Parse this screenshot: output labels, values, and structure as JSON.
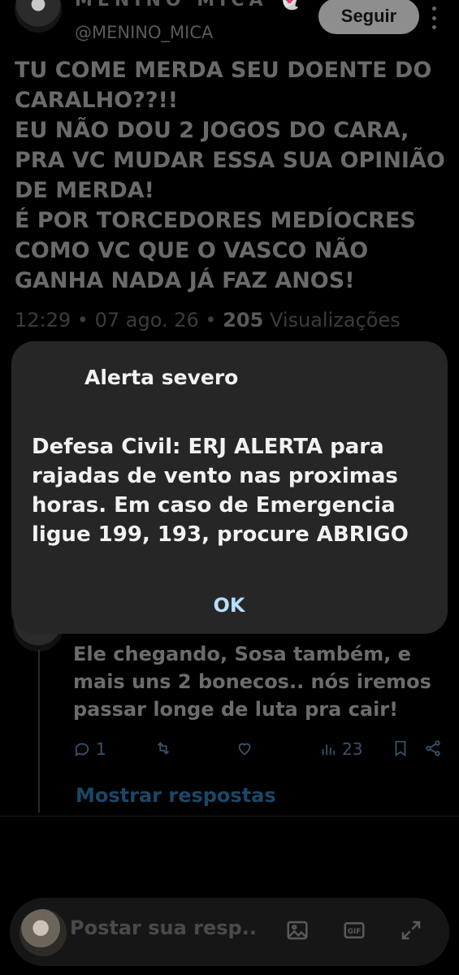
{
  "tweet": {
    "display_name": "MENINO MICA 👻",
    "handle": "@MENINO_MICA",
    "follow_label": "Seguir",
    "text_lines": [
      "TU COME MERDA SEU DOENTE DO",
      "CARALHO??!!",
      "EU NÃO DOU 2 JOGOS DO CARA,",
      "PRA VC MUDAR ESSA SUA OPINIÃO",
      "DE MERDA!",
      "É POR TORCEDORES MEDÍOCRES",
      "COMO VC QUE O VASCO NÃO",
      "GANHA NADA JÁ FAZ ANOS!"
    ],
    "time": "12:29",
    "date": "07 ago. 26",
    "views_count": "205",
    "views_label": "Visualizações"
  },
  "reply": {
    "text_lines": [
      "Ele chegando, Sosa também, e",
      "mais uns 2 bonecos.. nós iremos",
      "passar longe de luta pra cair!"
    ],
    "reply_count": "1",
    "retweet_count": "",
    "like_count": "",
    "views_count": "23",
    "show_replies_label": "Mostrar respostas"
  },
  "alert": {
    "title": "Alerta severo",
    "body_lines": [
      "Defesa Civil: ERJ ALERTA para",
      "rajadas de vento nas proximas",
      "horas. Em caso de Emergencia",
      "ligue 199, 193, procure ABRIGO"
    ],
    "ok_label": "OK"
  },
  "compose": {
    "placeholder": "Postar sua resp..."
  },
  "colors": {
    "background": "#000000",
    "dialog": "#262626",
    "ok_accent": "#b7dcff",
    "link_blue": "#1c4766"
  }
}
